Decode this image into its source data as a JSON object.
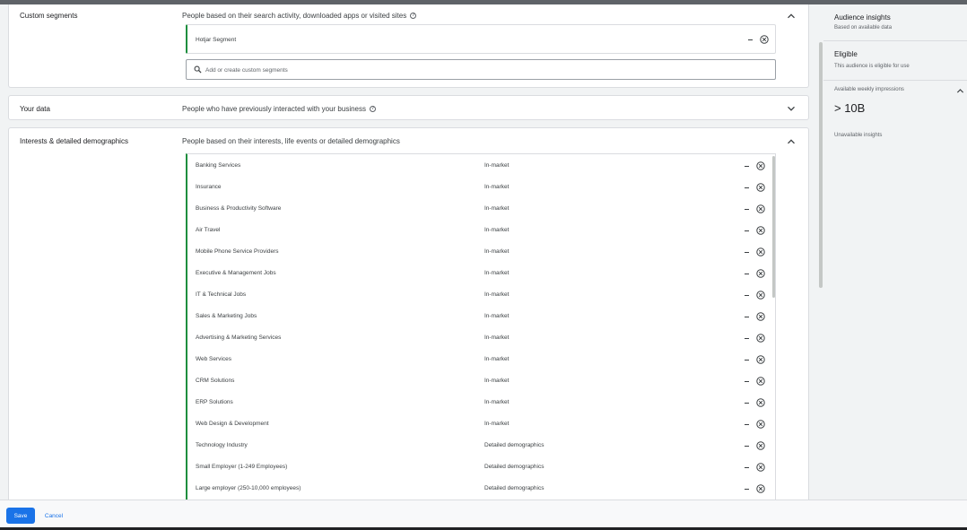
{
  "custom_segments": {
    "title": "Custom segments",
    "description": "People based on their search activity, downloaded apps or visited sites",
    "selected": [
      {
        "name": "Hotjar Segment"
      }
    ],
    "search_placeholder": "Add or create custom segments"
  },
  "your_data": {
    "title": "Your data",
    "description": "People who have previously interacted with your business"
  },
  "interests": {
    "title": "Interests & detailed demographics",
    "description": "People based on their interests, life events or detailed demographics",
    "items": [
      {
        "name": "Banking Services",
        "type": "In-market"
      },
      {
        "name": "Insurance",
        "type": "In-market"
      },
      {
        "name": "Business & Productivity Software",
        "type": "In-market"
      },
      {
        "name": "Air Travel",
        "type": "In-market"
      },
      {
        "name": "Mobile Phone Service Providers",
        "type": "In-market"
      },
      {
        "name": "Executive & Management Jobs",
        "type": "In-market"
      },
      {
        "name": "IT & Technical Jobs",
        "type": "In-market"
      },
      {
        "name": "Sales & Marketing Jobs",
        "type": "In-market"
      },
      {
        "name": "Advertising & Marketing Services",
        "type": "In-market"
      },
      {
        "name": "Web Services",
        "type": "In-market"
      },
      {
        "name": "CRM Solutions",
        "type": "In-market"
      },
      {
        "name": "ERP Solutions",
        "type": "In-market"
      },
      {
        "name": "Web Design & Development",
        "type": "In-market"
      },
      {
        "name": "Technology Industry",
        "type": "Detailed demographics"
      },
      {
        "name": "Small Employer (1-249 Employees)",
        "type": "Detailed demographics"
      },
      {
        "name": "Large employer (250-10,000 employees)",
        "type": "Detailed demographics"
      }
    ]
  },
  "insights": {
    "title": "Audience insights",
    "subtitle": "Based on available data",
    "status": "Eligible",
    "status_desc": "This audience is eligible for use",
    "impressions_label": "Available weekly impressions",
    "impressions_value": "> 10B",
    "unavailable": "Unavailable insights"
  },
  "footer": {
    "save": "Save",
    "cancel": "Cancel"
  },
  "icons": {
    "help": "help-circle-icon",
    "expand": "chevron-up-icon",
    "collapse": "chevron-down-icon",
    "remove": "close-circle-icon",
    "exclude": "minus-icon",
    "search": "search-icon"
  },
  "colors": {
    "primary": "#1a73e8",
    "accent_bar": "#1e8e3e",
    "background": "#f1f3f4"
  }
}
